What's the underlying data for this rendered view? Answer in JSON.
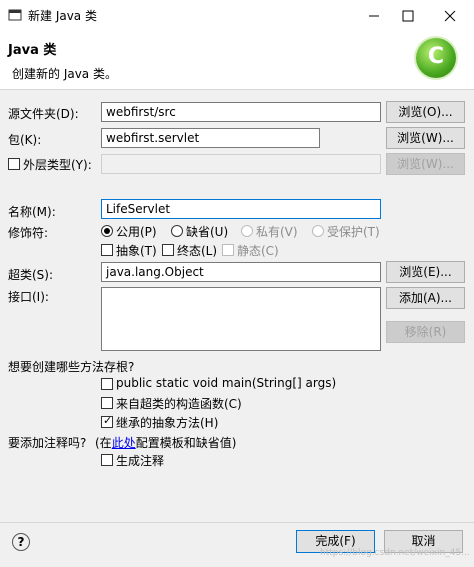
{
  "window": {
    "title": "新建 Java 类"
  },
  "header": {
    "title": "Java 类",
    "description": "创建新的 Java 类。"
  },
  "form": {
    "source_folder": {
      "label": "源文件夹(D):",
      "value": "webfirst/src",
      "browse": "浏览(O)..."
    },
    "package": {
      "label": "包(K):",
      "value": "webfirst.servlet",
      "browse": "浏览(W)..."
    },
    "enclosing_type": {
      "label": "外层类型(Y):",
      "value": "",
      "browse": "浏览(W)...",
      "checked": false
    },
    "name": {
      "label": "名称(M):",
      "value": "LifeServlet"
    },
    "modifiers": {
      "label": "修饰符:",
      "public": "公用(P)",
      "default": "缺省(U)",
      "private": "私有(V)",
      "protected": "受保护(T)",
      "abstract": "抽象(T)",
      "final": "终态(L)",
      "static": "静态(C)",
      "selected": "public"
    },
    "superclass": {
      "label": "超类(S):",
      "value": "java.lang.Object",
      "browse": "浏览(E)..."
    },
    "interfaces": {
      "label": "接口(I):",
      "add": "添加(A)...",
      "remove": "移除(R)"
    }
  },
  "stubs": {
    "question": "想要创建哪些方法存根?",
    "main": {
      "label": "public static void main(String[] args)",
      "checked": false
    },
    "constructors": {
      "label": "来自超类的构造函数(C)",
      "checked": false
    },
    "inherited": {
      "label": "继承的抽象方法(H)",
      "checked": true
    }
  },
  "comments": {
    "question": "要添加注释吗?",
    "hint_prefix": "(在",
    "hint_link": "此处",
    "hint_suffix": "配置模板和缺省值)",
    "generate": {
      "label": "生成注释",
      "checked": false
    }
  },
  "footer": {
    "finish": "完成(F)",
    "cancel": "取消",
    "help": "?",
    "watermark": "https://blog.csdn.net/weixin_45..."
  },
  "colors": {
    "accent": "#0078d7",
    "logo_green": "#4aa820"
  }
}
